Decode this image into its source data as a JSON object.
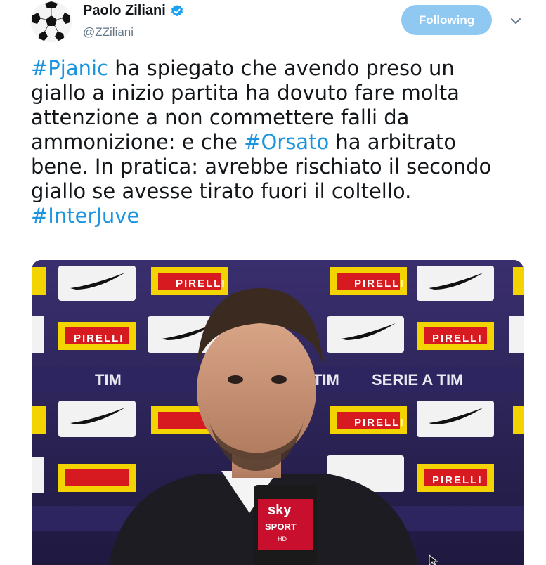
{
  "user": {
    "display_name": "Paolo Ziliani",
    "handle": "@ZZiliani",
    "verified": true,
    "avatar_icon": "soccer-ball-icon"
  },
  "follow_button": {
    "label": "Following",
    "color": "#8fc9f2"
  },
  "menu_icon": "chevron-down-icon",
  "tweet": {
    "lines": [
      [
        {
          "t": "#Pjanic",
          "h": true
        },
        {
          "t": " ha spiegato che avendo preso un",
          "h": false
        }
      ],
      [
        {
          "t": "giallo a inizio partita ha dovuto fare molta",
          "h": false
        }
      ],
      [
        {
          "t": "attenzione a non commettere falli da",
          "h": false
        }
      ],
      [
        {
          "t": "ammonizione: e che ",
          "h": false
        },
        {
          "t": "#Orsato",
          "h": true
        },
        {
          "t": " ha arbitrato",
          "h": false
        }
      ],
      [
        {
          "t": "bene. In pratica: avrebbe rischiato il secondo",
          "h": false
        }
      ],
      [
        {
          "t": "giallo se avesse tirato fuori il coltello.",
          "h": false
        }
      ],
      [
        {
          "t": "#InterJuve",
          "h": true
        }
      ]
    ],
    "hashtag_color": "#1b95e0"
  },
  "media": {
    "backdrop_texts": {
      "sponsor_a": "PIRELLI",
      "sponsor_b": "TIM",
      "league": "SERIE A TIM",
      "mic_brand": "sky",
      "mic_sub": "SPORT",
      "mic_hd": "HD"
    }
  }
}
